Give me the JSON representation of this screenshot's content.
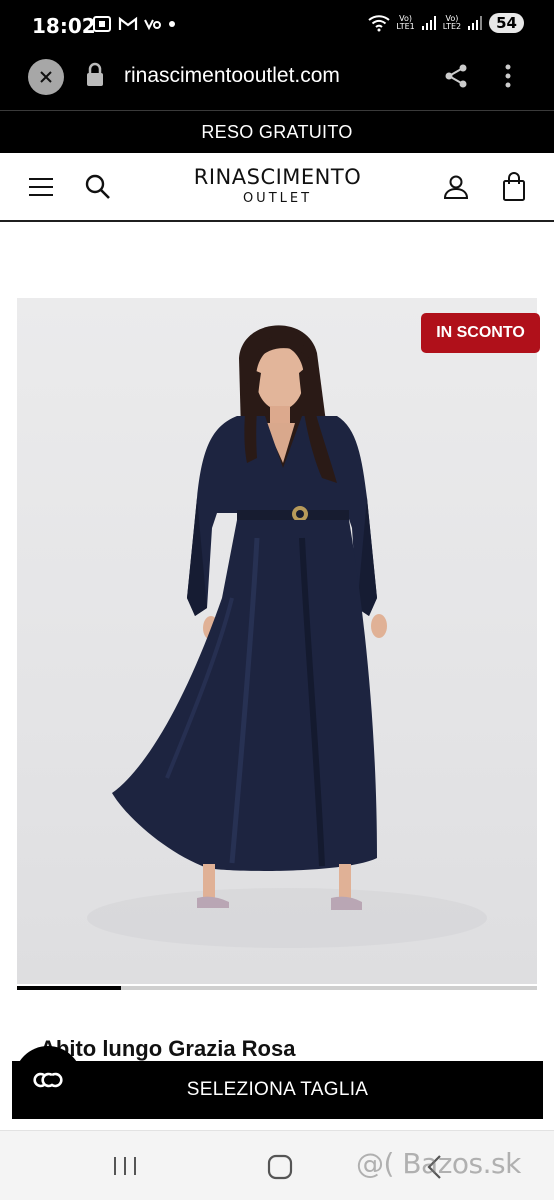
{
  "status_bar": {
    "time": "18:02",
    "sim1_label": "Vo)\nLTE1",
    "sim2_label": "Vo)\nLTE2",
    "battery": "54"
  },
  "browser": {
    "url": "rinascimentooutlet.com"
  },
  "promo": {
    "text": "RESO GRATUITO"
  },
  "header": {
    "logo_main": "RINASCIMENTO",
    "logo_sub": "OUTLET"
  },
  "product": {
    "badge": "IN SCONTO",
    "title": "Abito lungo Grazia Rosa",
    "carousel_progress": 0.2
  },
  "cta": {
    "label": "SELEZIONA TAGLIA"
  },
  "watermark": {
    "text": "@( Bazos.sk"
  },
  "colors": {
    "badge_red": "#b0101a",
    "dress_navy": "#1d2440",
    "bar_black": "#000000"
  }
}
